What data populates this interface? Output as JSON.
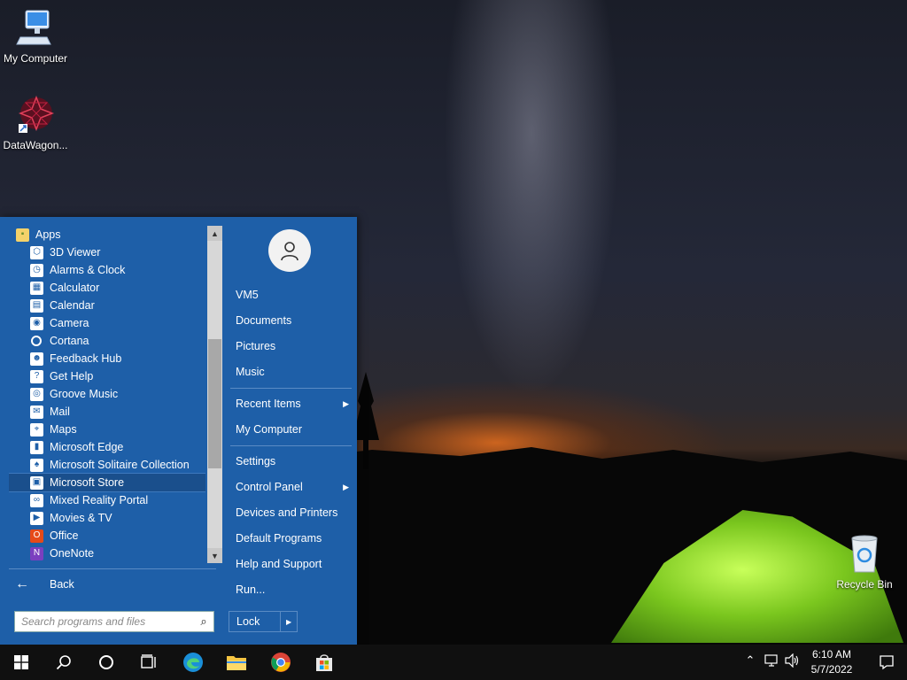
{
  "desktop": {
    "icons": [
      {
        "label": "My Computer"
      },
      {
        "label": "DataWagon..."
      },
      {
        "label": "Recycle Bin"
      }
    ]
  },
  "start_menu": {
    "apps_folder": "Apps",
    "apps": [
      {
        "label": "3D Viewer",
        "icon": "cube-icon"
      },
      {
        "label": "Alarms & Clock",
        "icon": "clock-icon"
      },
      {
        "label": "Calculator",
        "icon": "calculator-icon"
      },
      {
        "label": "Calendar",
        "icon": "calendar-icon"
      },
      {
        "label": "Camera",
        "icon": "camera-icon"
      },
      {
        "label": "Cortana",
        "icon": "cortana-icon"
      },
      {
        "label": "Feedback Hub",
        "icon": "feedback-icon"
      },
      {
        "label": "Get Help",
        "icon": "help-icon"
      },
      {
        "label": "Groove Music",
        "icon": "music-icon"
      },
      {
        "label": "Mail",
        "icon": "mail-icon"
      },
      {
        "label": "Maps",
        "icon": "maps-icon"
      },
      {
        "label": "Microsoft Edge",
        "icon": "edge-icon"
      },
      {
        "label": "Microsoft Solitaire Collection",
        "icon": "cards-icon"
      },
      {
        "label": "Microsoft Store",
        "icon": "store-icon"
      },
      {
        "label": "Mixed Reality Portal",
        "icon": "vr-headset-icon"
      },
      {
        "label": "Movies & TV",
        "icon": "film-icon"
      },
      {
        "label": "Office",
        "icon": "office-icon"
      },
      {
        "label": "OneNote",
        "icon": "onenote-icon"
      }
    ],
    "selected_app": "Microsoft Store",
    "back_label": "Back",
    "search_placeholder": "Search programs and files",
    "right": {
      "user": "VM5",
      "documents": "Documents",
      "pictures": "Pictures",
      "music": "Music",
      "recent_items": "Recent Items",
      "my_computer": "My Computer",
      "settings": "Settings",
      "control_panel": "Control Panel",
      "devices_printers": "Devices and Printers",
      "default_programs": "Default Programs",
      "help_support": "Help and Support",
      "run": "Run...",
      "lock": "Lock"
    }
  },
  "taskbar": {
    "time": "6:10 AM",
    "date": "5/7/2022"
  },
  "colors": {
    "start_menu_bg": "#1e5fa8",
    "taskbar_bg": "#101010"
  }
}
